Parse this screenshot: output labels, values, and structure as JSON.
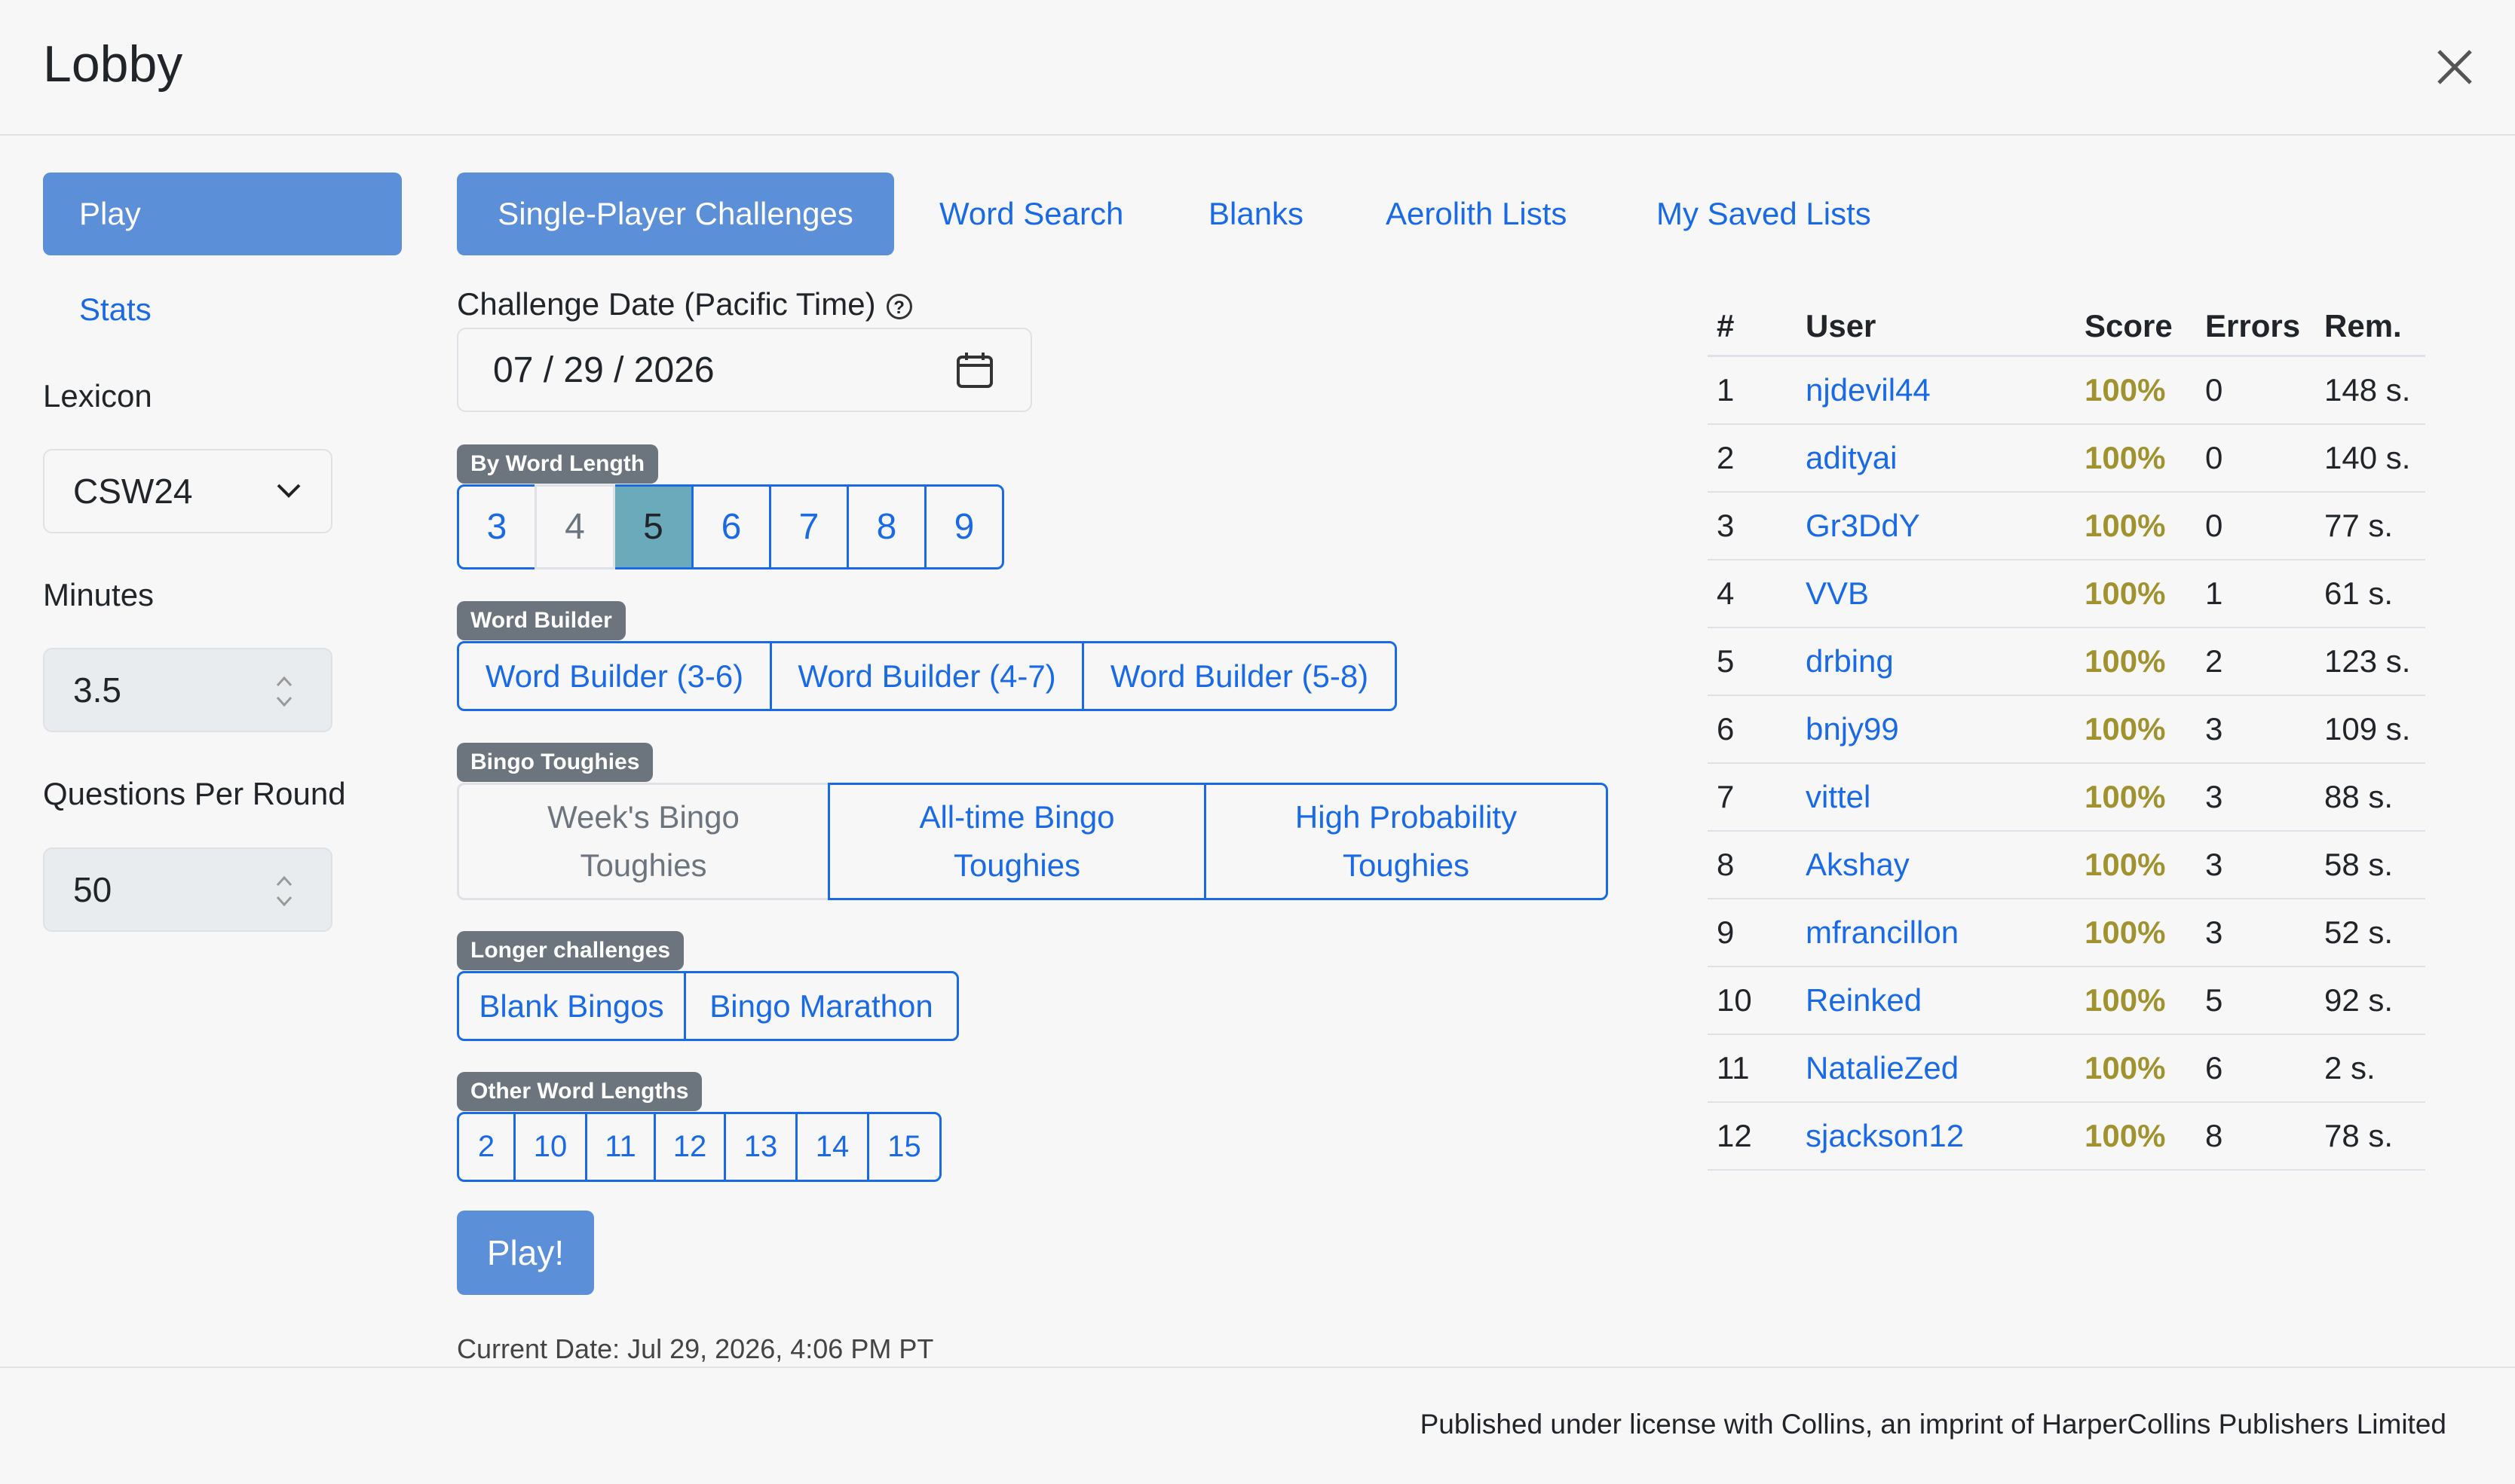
{
  "modal": {
    "title": "Lobby"
  },
  "left": {
    "play_label": "Play",
    "stats_label": "Stats",
    "lexicon_label": "Lexicon",
    "lexicon_value": "CSW24",
    "minutes_label": "Minutes",
    "minutes_value": "3.5",
    "qpr_label": "Questions Per Round",
    "qpr_value": "50"
  },
  "tabs": [
    {
      "label": "Single-Player Challenges",
      "active": true
    },
    {
      "label": "Word Search"
    },
    {
      "label": "Blanks"
    },
    {
      "label": "Aerolith Lists"
    },
    {
      "label": "My Saved Lists"
    }
  ],
  "challenge": {
    "date_label": "Challenge Date (Pacific Time)",
    "help_icon": "?",
    "date_value": "07 / 29 / 2026",
    "groups": {
      "by_length": {
        "title": "By Word Length",
        "buttons": [
          "3",
          "4",
          "5",
          "6",
          "7",
          "8",
          "9"
        ],
        "disabled": "4",
        "selected": "5"
      },
      "word_builder": {
        "title": "Word Builder",
        "buttons": [
          "Word Builder (3-6)",
          "Word Builder (4-7)",
          "Word Builder (5-8)"
        ]
      },
      "bingo_toughies": {
        "title": "Bingo Toughies",
        "buttons": [
          "Week's Bingo Toughies",
          "All-time Bingo Toughies",
          "High Probability Toughies"
        ],
        "line1": [
          "Week's Bingo",
          "All-time Bingo",
          "High Probability"
        ],
        "line2": [
          "Toughies",
          "Toughies",
          "Toughies"
        ]
      },
      "longer": {
        "title": "Longer challenges",
        "buttons": [
          "Blank Bingos",
          "Bingo Marathon"
        ]
      },
      "other_lengths": {
        "title": "Other Word Lengths",
        "buttons": [
          "2",
          "10",
          "11",
          "12",
          "13",
          "14",
          "15"
        ]
      }
    },
    "play_button": "Play!",
    "current_date": "Current Date: Jul 29, 2026, 4:06 PM PT"
  },
  "leaderboard": {
    "headers": [
      "#",
      "User",
      "Score",
      "Errors",
      "Rem."
    ],
    "rows": [
      [
        "1",
        "njdevil44",
        "100%",
        "0",
        "148 s."
      ],
      [
        "2",
        "adityai",
        "100%",
        "0",
        "140 s."
      ],
      [
        "3",
        "Gr3DdY",
        "100%",
        "0",
        "77 s."
      ],
      [
        "4",
        "VVB",
        "100%",
        "1",
        "61 s."
      ],
      [
        "5",
        "drbing",
        "100%",
        "2",
        "123 s."
      ],
      [
        "6",
        "bnjy99",
        "100%",
        "3",
        "109 s."
      ],
      [
        "7",
        "vittel",
        "100%",
        "3",
        "88 s."
      ],
      [
        "8",
        "Akshay",
        "100%",
        "3",
        "58 s."
      ],
      [
        "9",
        "mfrancillon",
        "100%",
        "3",
        "52 s."
      ],
      [
        "10",
        "Reinked",
        "100%",
        "5",
        "92 s."
      ],
      [
        "11",
        "NatalieZed",
        "100%",
        "6",
        "2 s."
      ],
      [
        "12",
        "sjackson12",
        "100%",
        "8",
        "78 s."
      ]
    ]
  },
  "footer": {
    "text": "Published under license with Collins, an imprint of HarperCollins Publishers Limited"
  },
  "colors": {
    "primary": "#5b8fd8",
    "link": "#1a6ae6",
    "selected": "#6aaabb",
    "score": "#a0922e",
    "badge": "#6c757d"
  },
  "icons": {
    "close": "close-icon",
    "calendar": "calendar-icon",
    "help": "help-icon",
    "dropdown": "chevron-down-icon",
    "spinner": "spinner-arrows-icon"
  }
}
